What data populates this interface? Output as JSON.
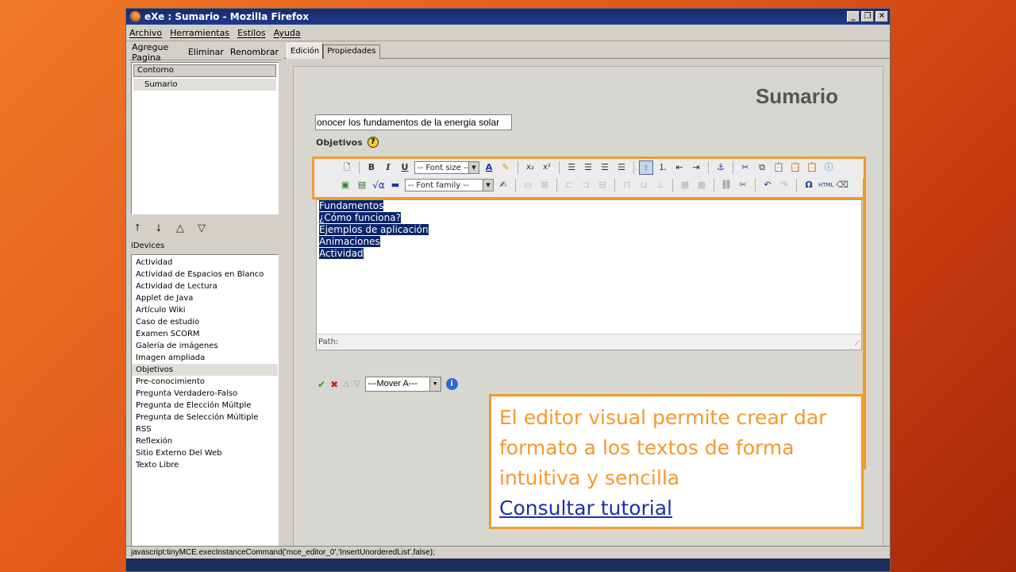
{
  "window": {
    "title": "eXe : Sumario - Mozilla Firefox",
    "controls": [
      "_",
      "❐",
      "✕"
    ]
  },
  "menu": [
    "Archivo",
    "Herramientas",
    "Estilos",
    "Ayuda"
  ],
  "left_panel": {
    "actions": [
      "Agregue Pagina",
      "Eliminar",
      "Renombrar"
    ],
    "outline_header": "Contorno",
    "outline_items": [
      "Sumario"
    ],
    "move_arrows": [
      "⭡",
      "⭣",
      "△",
      "▽"
    ],
    "idevices_header": "iDevices",
    "idevices": [
      "Actividad",
      "Actividad de Espacios en Blanco",
      "Actividad de Lectura",
      "Applet de Java",
      "Artículo Wiki",
      "Caso de estudio",
      "Examen SCORM",
      "Galería de imágenes",
      "Imagen ampliada",
      "Objetivos",
      "Pre-conocimiento",
      "Pregunta Verdadero-Falso",
      "Pregunta de Elección Múltple",
      "Pregunta de Selección Múltiple",
      "RSS",
      "Reflexión",
      "Sitio Externo Del Web",
      "Texto Libre"
    ],
    "selected_idevice": "Objetivos"
  },
  "tabs": [
    "Edición",
    "Propiedades"
  ],
  "content": {
    "page_title": "Sumario",
    "title_input_value": "onocer los fundamentos de la energia solar",
    "objetivos_label": "Objetivos",
    "help_icon": "?",
    "toolbar": {
      "font_size_label": "-- Font size --",
      "font_family_label": "-- Font family --"
    },
    "editor_lines": [
      "Fundamentos",
      "¿Cómo funciona?",
      "Ejemplos de aplicación",
      "Animaciones",
      "Actividad"
    ],
    "path_label": "Path:",
    "mover_label": "---Mover A---"
  },
  "statusbar": "javascript:tinyMCE.execInstanceCommand('mce_editor_0','InsertUnorderedList',false);",
  "callout": {
    "text_lines": [
      "El editor visual permite crear dar",
      "formato a los textos de forma",
      "intuitiva y sencilla"
    ],
    "link_text": "Consultar tutorial"
  },
  "colors": {
    "accent_orange": "#f29a2c",
    "selection_blue": "#0a246a",
    "link_blue": "#1a2fb0"
  }
}
